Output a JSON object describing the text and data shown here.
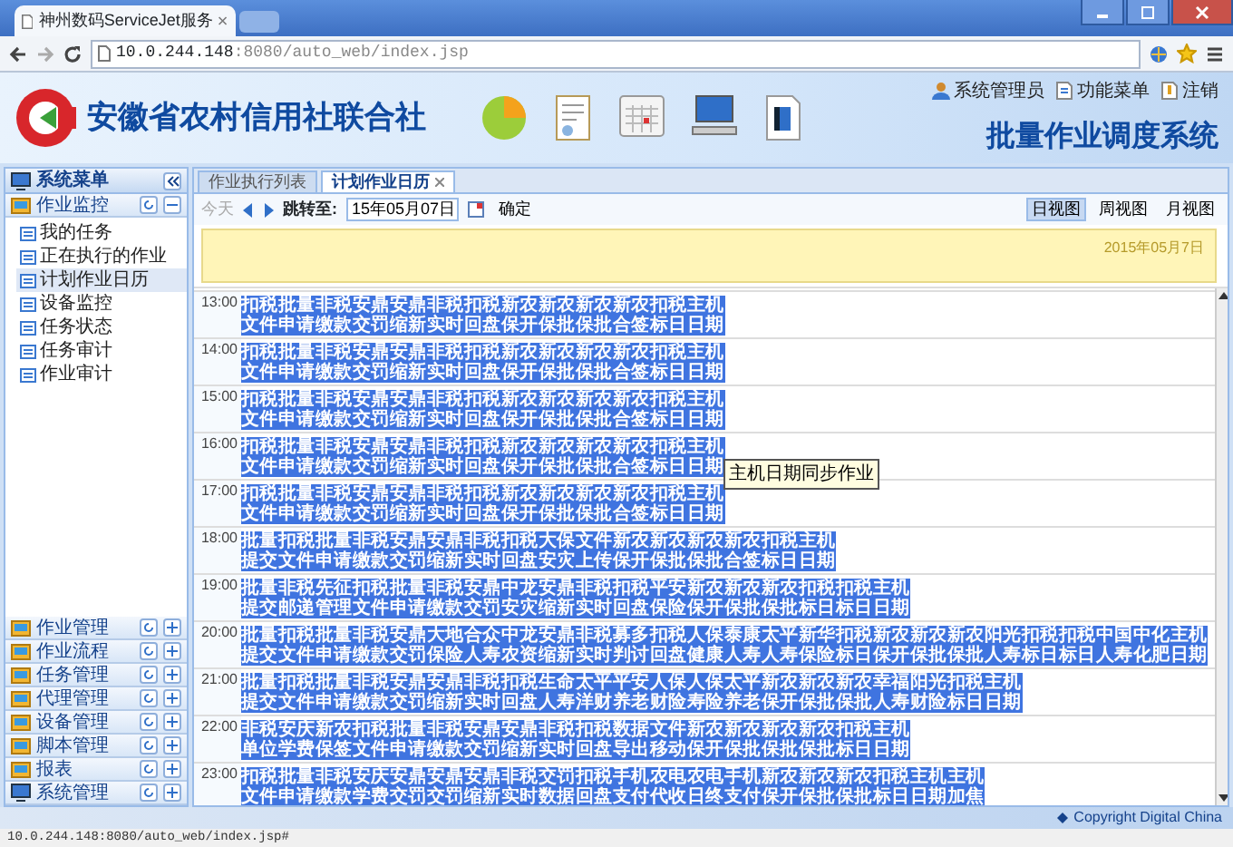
{
  "browser": {
    "tab_title": "神州数码ServiceJet服务",
    "url_host": "10.0.244.148",
    "url_rest": ":8080/auto_web/index.jsp",
    "status_url": "10.0.244.148:8080/auto_web/index.jsp#"
  },
  "header": {
    "org_name": "安徽省农村信用社联合社",
    "system_title": "批量作业调度系统",
    "user_links": [
      "系统管理员",
      "功能菜单",
      "注销"
    ]
  },
  "sidebar": {
    "title": "系统菜单",
    "groups": [
      {
        "label": "作业监控",
        "expanded": true,
        "items": [
          {
            "label": "我的任务",
            "selected": false
          },
          {
            "label": "正在执行的作业",
            "selected": false
          },
          {
            "label": "计划作业日历",
            "selected": true
          },
          {
            "label": "设备监控",
            "selected": false
          },
          {
            "label": "任务状态",
            "selected": false
          },
          {
            "label": "任务审计",
            "selected": false
          },
          {
            "label": "作业审计",
            "selected": false
          }
        ]
      },
      {
        "label": "作业管理",
        "expanded": false
      },
      {
        "label": "作业流程",
        "expanded": false
      },
      {
        "label": "任务管理",
        "expanded": false
      },
      {
        "label": "代理管理",
        "expanded": false
      },
      {
        "label": "设备管理",
        "expanded": false
      },
      {
        "label": "脚本管理",
        "expanded": false
      },
      {
        "label": "报表",
        "expanded": false
      },
      {
        "label": "系统管理",
        "expanded": false
      }
    ]
  },
  "content_tabs": [
    {
      "label": "作业执行列表",
      "selected": false
    },
    {
      "label": "计划作业日历",
      "selected": true
    }
  ],
  "toolbar": {
    "today": {
      "label": "今天",
      "disabled": true
    },
    "jump_label": "跳转至:",
    "date_value": "15年05月07日",
    "confirm_label": "确定",
    "views": [
      {
        "label": "日视图",
        "selected": true
      },
      {
        "label": "周视图",
        "selected": false
      },
      {
        "label": "月视图",
        "selected": false
      }
    ]
  },
  "day_banner": "2015年05月7日",
  "schedule": [
    {
      "time": "13:00",
      "events": [
        "扣税文件",
        "批量申请",
        "非税缴款",
        "安鼎交罚",
        "安鼎缩新",
        "非税实时",
        "扣税回盘",
        "新农保开",
        "新农保批",
        "新农保批",
        "新农合签",
        "扣税标日",
        "主机日期"
      ]
    },
    {
      "time": "14:00",
      "events": [
        "扣税文件",
        "批量申请",
        "非税缴款",
        "安鼎交罚",
        "安鼎缩新",
        "非税实时",
        "扣税回盘",
        "新农保开",
        "新农保批",
        "新农保批",
        "新农合签",
        "扣税标日",
        "主机日期"
      ]
    },
    {
      "time": "15:00",
      "events": [
        "扣税文件",
        "批量申请",
        "非税缴款",
        "安鼎交罚",
        "安鼎缩新",
        "非税实时",
        "扣税回盘",
        "新农保开",
        "新农保批",
        "新农保批",
        "新农合签",
        "扣税标日",
        "主机日期"
      ]
    },
    {
      "time": "16:00",
      "events": [
        "扣税文件",
        "批量申请",
        "非税缴款",
        "安鼎交罚",
        "安鼎缩新",
        "非税实时",
        "扣税回盘",
        "新农保开",
        "新农保批",
        "新农保批",
        "新农合签",
        "扣税标日",
        "主机日期"
      ],
      "tooltip": "主机日期同步作业"
    },
    {
      "time": "17:00",
      "events": [
        "扣税文件",
        "批量申请",
        "非税缴款",
        "安鼎交罚",
        "安鼎缩新",
        "非税实时",
        "扣税回盘",
        "新农保开",
        "新农保批",
        "新农保批",
        "新农合签",
        "扣税标日",
        "主机日期"
      ]
    },
    {
      "time": "18:00",
      "events": [
        "批量提交",
        "扣税文件",
        "批量申请",
        "非税缴款",
        "安鼎交罚",
        "安鼎缩新",
        "非税实时",
        "扣税回盘",
        "大保安灾",
        "文件上传",
        "新农保开",
        "新农保批",
        "新农保批",
        "新农合签",
        "扣税标日",
        "主机日期"
      ]
    },
    {
      "time": "19:00",
      "events": [
        "批量提交",
        "非税邮递",
        "先征管理",
        "扣税文件",
        "批量申请",
        "非税缴款",
        "安鼎交罚",
        "中龙安灾",
        "安鼎缩新",
        "非税实时",
        "扣税回盘",
        "平安保险",
        "新农保开",
        "新农保批",
        "新农保批",
        "扣税标日",
        "扣税标日",
        "主机日期"
      ]
    },
    {
      "time": "20:00",
      "events": [
        "批量提交",
        "扣税文件",
        "批量申请",
        "非税缴款",
        "安鼎交罚",
        "大地保险",
        "合众人寿",
        "中龙农资",
        "安鼎缩新",
        "非税实时",
        "募多判讨",
        "扣税回盘",
        "人保健康",
        "泰康人寿",
        "太平人寿",
        "新华保险",
        "扣税标日",
        "新农保开",
        "新农保批",
        "新农保批",
        "阳光人寿",
        "扣税标日",
        "扣税标日",
        "中国人寿",
        "中化化肥",
        "主机日期"
      ]
    },
    {
      "time": "21:00",
      "events": [
        "批量提交",
        "扣税文件",
        "批量申请",
        "非税缴款",
        "安鼎交罚",
        "安鼎缩新",
        "非税实时",
        "扣税回盘",
        "生命人寿",
        "太平洋财",
        "平安养老",
        "人保财险",
        "人保寿险",
        "太平养老",
        "新农保开",
        "新农保批",
        "新农保批",
        "幸福人寿",
        "阳光财险",
        "扣税标日",
        "主机日期"
      ]
    },
    {
      "time": "22:00",
      "events": [
        "非税单位",
        "安庆学费",
        "新农保签",
        "扣税文件",
        "批量申请",
        "非税缴款",
        "安鼎交罚",
        "安鼎缩新",
        "非税实时",
        "扣税回盘",
        "数据导出",
        "文件移动",
        "新农保开",
        "新农保批",
        "新农保批",
        "新农保批",
        "扣税标日",
        "主机日期"
      ]
    },
    {
      "time": "23:00",
      "events": [
        "扣税文件",
        "批量申请",
        "非税缴款",
        "安庆学费",
        "安鼎交罚",
        "安鼎交罚",
        "安鼎缩新",
        "非税实时",
        "交罚数据",
        "扣税回盘",
        "手机支付",
        "农电代收",
        "农电日终",
        "手机支付",
        "新农保开",
        "新农保批",
        "新农保批",
        "扣税标日",
        "主机日期",
        "主机加焦"
      ]
    }
  ],
  "footer": {
    "copyright": "Copyright Digital China"
  }
}
